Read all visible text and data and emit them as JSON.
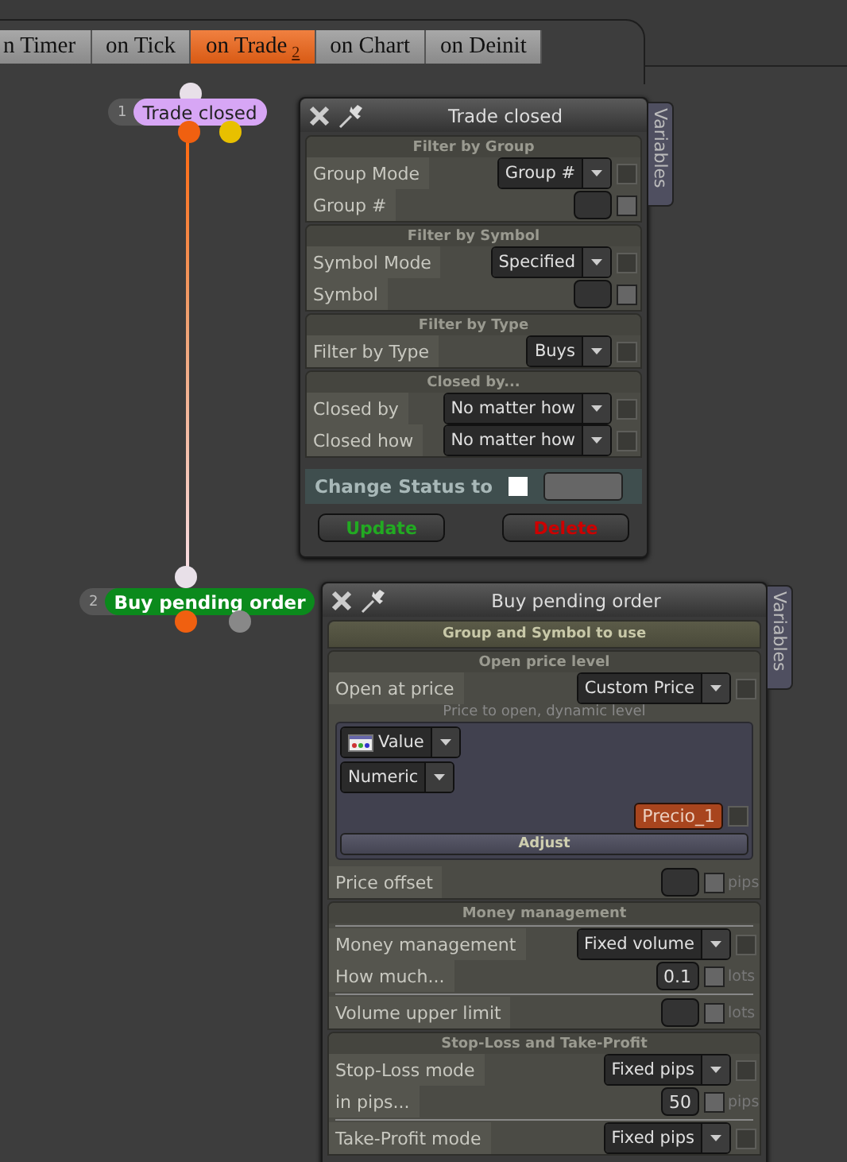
{
  "tabs": [
    {
      "label": "n Timer",
      "selected": false
    },
    {
      "label": "on Tick",
      "selected": false
    },
    {
      "label": "on Trade",
      "selected": true,
      "badge": "2"
    },
    {
      "label": "on Chart",
      "selected": false
    },
    {
      "label": "on Deinit",
      "selected": false
    }
  ],
  "nodes": [
    {
      "number": "1",
      "label": "Trade closed",
      "color": "#d7a6f5"
    },
    {
      "number": "2",
      "label": "Buy pending order",
      "color": "#0b8a1c"
    }
  ],
  "panels": [
    {
      "title": "Trade closed",
      "side_tab": "Variables",
      "sections": [
        {
          "title": "Filter by Group",
          "expanded": true,
          "rows": [
            {
              "kind": "select",
              "label": "Group Mode",
              "value": "Group #",
              "checked": false
            },
            {
              "kind": "input",
              "label": "Group #",
              "checked": false
            }
          ]
        },
        {
          "title": "Filter by Symbol",
          "expanded": true,
          "rows": [
            {
              "kind": "select",
              "label": "Symbol Mode",
              "value": "Specified",
              "checked": false
            },
            {
              "kind": "input",
              "label": "Symbol",
              "checked": false
            }
          ]
        },
        {
          "title": "Filter by Type",
          "expanded": true,
          "rows": [
            {
              "kind": "select",
              "label": "Filter by Type",
              "value": "Buys",
              "checked": false
            }
          ]
        },
        {
          "title": "Closed by...",
          "expanded": true,
          "rows": [
            {
              "kind": "select",
              "label": "Closed by",
              "value": "No matter how",
              "checked": false
            },
            {
              "kind": "select",
              "label": "Closed how",
              "value": "No matter how",
              "checked": false
            }
          ]
        }
      ],
      "status": {
        "label": "Change Status to",
        "checked": false
      },
      "buttons": [
        {
          "label": "Update",
          "kind": "update"
        },
        {
          "label": "Delete",
          "kind": "delete"
        }
      ]
    },
    {
      "title": "Buy pending order",
      "side_tab": "Variables",
      "sections": [
        {
          "title": "Group and Symbol to use",
          "expanded": false
        },
        {
          "title": "Open price level",
          "expanded": true,
          "rows": [
            {
              "kind": "select",
              "label": "Open at price",
              "value": "Custom Price",
              "checked": false
            },
            {
              "kind": "dynamic",
              "caption": "Price to open, dynamic level",
              "selects": [
                "Value",
                "Numeric"
              ],
              "variable": "Precio_1",
              "checked": false,
              "button": "Adjust"
            },
            {
              "kind": "input",
              "label": "Price offset",
              "unit": "pips",
              "checked": false
            }
          ]
        },
        {
          "title": "Money management",
          "expanded": true,
          "rows": [
            {
              "kind": "divider"
            },
            {
              "kind": "select",
              "label": "Money management",
              "value": "Fixed volume",
              "checked": false
            },
            {
              "kind": "input",
              "label": "How much...",
              "value": "0.1",
              "unit": "lots",
              "checked": false
            },
            {
              "kind": "divider"
            },
            {
              "kind": "input",
              "label": "Volume upper limit",
              "unit": "lots",
              "checked": false
            }
          ]
        },
        {
          "title": "Stop-Loss and Take-Profit",
          "expanded": true,
          "rows": [
            {
              "kind": "select",
              "label": "Stop-Loss mode",
              "value": "Fixed pips",
              "checked": false
            },
            {
              "kind": "input",
              "label": "in pips...",
              "value": "50",
              "unit": "pips",
              "checked": false
            },
            {
              "kind": "divider"
            },
            {
              "kind": "select",
              "label": "Take-Profit mode",
              "value": "Fixed pips",
              "checked": false
            }
          ]
        }
      ]
    }
  ]
}
